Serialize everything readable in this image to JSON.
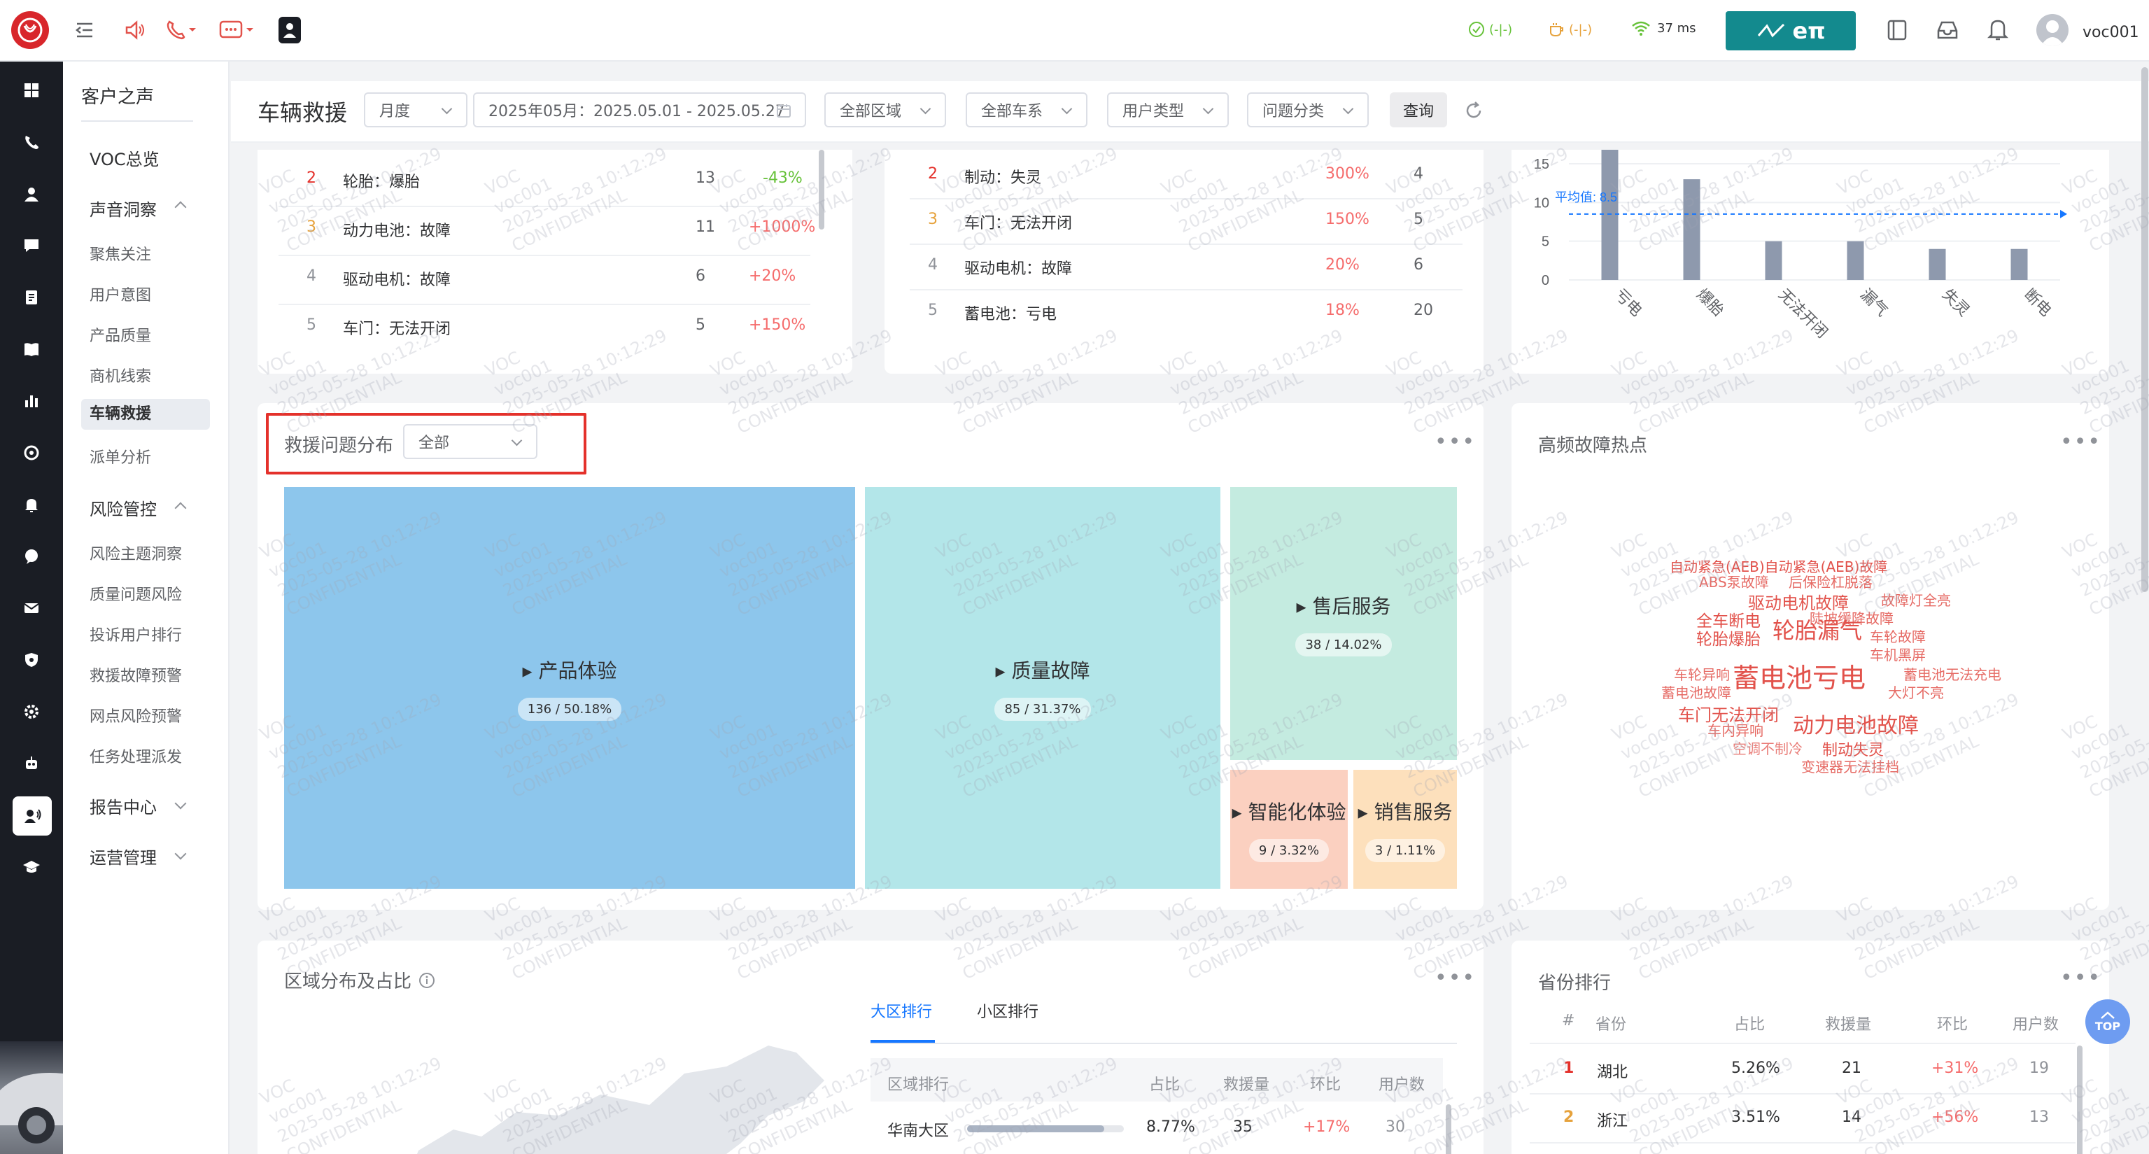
{
  "topbar": {
    "latency": "37 ms",
    "status1": "(-|-)",
    "status2": "(-|-)",
    "brand": "eπ",
    "user": "voc001"
  },
  "submenu": {
    "title": "客户之声",
    "items": [
      {
        "label": "VOC总览",
        "type": "group"
      },
      {
        "label": "声音洞察",
        "type": "group"
      },
      {
        "label": "聚焦关注",
        "type": "sub"
      },
      {
        "label": "用户意图",
        "type": "sub"
      },
      {
        "label": "产品质量",
        "type": "sub"
      },
      {
        "label": "商机线索",
        "type": "sub"
      },
      {
        "label": "车辆救援",
        "type": "active"
      },
      {
        "label": "派单分析",
        "type": "sub"
      },
      {
        "label": "风险管控",
        "type": "group"
      },
      {
        "label": "风险主题洞察",
        "type": "sub"
      },
      {
        "label": "质量问题风险",
        "type": "sub"
      },
      {
        "label": "投诉用户排行",
        "type": "sub"
      },
      {
        "label": "救援故障预警",
        "type": "sub"
      },
      {
        "label": "网点风险预警",
        "type": "sub"
      },
      {
        "label": "任务处理派发",
        "type": "sub"
      },
      {
        "label": "报告中心",
        "type": "group"
      },
      {
        "label": "运营管理",
        "type": "group"
      }
    ]
  },
  "filters": {
    "page_title": "车辆救援",
    "period": "月度",
    "date_range": "2025年05月：2025.05.01 - 2025.05.27",
    "region": "全部区域",
    "vehicle": "全部车系",
    "user_type": "用户类型",
    "issue_type": "问题分类",
    "query_button": "查询"
  },
  "top_list_left": [
    {
      "rank": "2",
      "name": "轮胎：爆胎",
      "count": "13",
      "change": "-43%"
    },
    {
      "rank": "3",
      "name": "动力电池：故障",
      "count": "11",
      "change": "+1000%"
    },
    {
      "rank": "4",
      "name": "驱动电机：故障",
      "count": "6",
      "change": "+20%"
    },
    {
      "rank": "5",
      "name": "车门：无法开闭",
      "count": "5",
      "change": "+150%"
    }
  ],
  "top_list_mid": [
    {
      "rank": "2",
      "name": "制动：失灵",
      "change": "300%",
      "count": "4"
    },
    {
      "rank": "3",
      "name": "车门：无法开闭",
      "change": "150%",
      "count": "5"
    },
    {
      "rank": "4",
      "name": "驱动电机：故障",
      "change": "20%",
      "count": "6"
    },
    {
      "rank": "5",
      "name": "蓄电池：亏电",
      "change": "18%",
      "count": "20"
    }
  ],
  "mini_chart": {
    "chart_data": {
      "type": "bar",
      "categories": [
        "亏电",
        "爆胎",
        "无法开闭",
        "漏气",
        "失灵",
        "断电"
      ],
      "values": [
        20,
        13,
        5,
        5,
        4,
        4
      ],
      "average_label": "平均值:",
      "average": "8.5",
      "ylim": [
        0,
        15
      ],
      "yticks": [
        "0",
        "5",
        "10",
        "15"
      ]
    }
  },
  "treemap": {
    "title": "救援问题分布",
    "filter": "全部",
    "more": "•••",
    "cells": [
      {
        "label": "产品体验",
        "value": "136 / 50.18%",
        "color": "#8dc6ec"
      },
      {
        "label": "质量故障",
        "value": "85 / 31.37%",
        "color": "#b3e6e9"
      },
      {
        "label": "售后服务",
        "value": "38 / 14.02%",
        "color": "#c4ebe0"
      },
      {
        "label": "智能化体验",
        "value": "9 / 3.32%",
        "color": "#fbd0c0"
      },
      {
        "label": "销售服务",
        "value": "3 / 1.11%",
        "color": "#fde0bc"
      }
    ]
  },
  "wordcloud": {
    "title": "高频故障热点",
    "more": "•••",
    "words": [
      "自动紧急(AEB)自动紧急(AEB)故障",
      "ABS泵故障",
      "后保险杠脱落",
      "驱动电机故障",
      "故障灯全亮",
      "全车断电",
      "陡坡缓降故障",
      "轮胎爆胎",
      "轮胎漏气",
      "车轮故障",
      "车机黑屏",
      "车轮异响",
      "蓄电池亏电",
      "蓄电池无法充电",
      "蓄电池故障",
      "大灯不亮",
      "车门无法开闭",
      "动力电池故障",
      "车内异响",
      "空调不制冷",
      "制动失灵",
      "变速器无法挂档"
    ]
  },
  "region": {
    "title": "区域分布及占比",
    "more": "•••",
    "tabs": [
      "大区排行",
      "小区排行"
    ],
    "headers": [
      "区域排行",
      "占比",
      "救援量",
      "环比",
      "用户数"
    ],
    "rows": [
      {
        "name": "华南大区",
        "share": "8.77%",
        "share_pct": 0.877,
        "count": "35",
        "change": "+17%",
        "users": "30"
      }
    ]
  },
  "province": {
    "title": "省份排行",
    "more": "•••",
    "headers": [
      "#",
      "省份",
      "占比",
      "救援量",
      "环比",
      "用户数"
    ],
    "rows": [
      {
        "rank": "1",
        "name": "湖北",
        "share": "5.26%",
        "count": "21",
        "change": "+31%",
        "users": "19"
      },
      {
        "rank": "2",
        "name": "浙江",
        "share": "3.51%",
        "count": "14",
        "change": "+56%",
        "users": "13"
      }
    ],
    "top_button": "TOP"
  },
  "watermark": {
    "l1": "VOC",
    "l2": "voc001",
    "l3": "2025-05-28 10:12:29",
    "l4": "CONFIDENTIAL"
  }
}
